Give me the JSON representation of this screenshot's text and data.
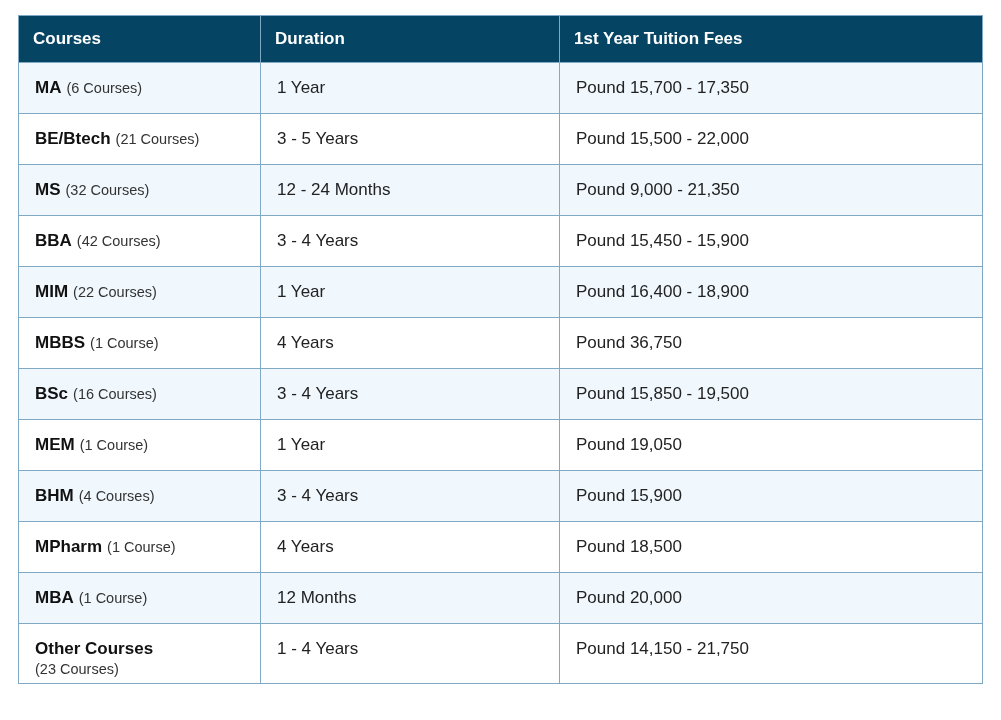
{
  "table": {
    "columns": [
      "Courses",
      "Duration",
      "1st Year Tuition Fees"
    ],
    "rows": [
      {
        "kind": "inline",
        "course": "MA",
        "count": "(6 Courses)",
        "duration": "1 Year",
        "fees": "Pound 15,700 - 17,350"
      },
      {
        "kind": "inline",
        "course": "BE/Btech",
        "count": "(21 Courses)",
        "duration": "3 - 5 Years",
        "fees": "Pound 15,500 - 22,000"
      },
      {
        "kind": "inline",
        "course": "MS",
        "count": "(32 Courses)",
        "duration": "12 - 24 Months",
        "fees": "Pound 9,000 - 21,350"
      },
      {
        "kind": "inline",
        "course": "BBA",
        "count": "(42 Courses)",
        "duration": "3 - 4 Years",
        "fees": "Pound 15,450 - 15,900"
      },
      {
        "kind": "inline",
        "course": "MIM",
        "count": "(22 Courses)",
        "duration": "1 Year",
        "fees": "Pound 16,400 - 18,900"
      },
      {
        "kind": "inline",
        "course": "MBBS",
        "count": "(1 Course)",
        "duration": "4 Years",
        "fees": "Pound 36,750"
      },
      {
        "kind": "inline",
        "course": "BSc",
        "count": "(16 Courses)",
        "duration": "3 - 4 Years",
        "fees": "Pound 15,850 - 19,500"
      },
      {
        "kind": "inline",
        "course": "MEM",
        "count": "(1 Course)",
        "duration": "1 Year",
        "fees": "Pound 19,050"
      },
      {
        "kind": "inline",
        "course": "BHM",
        "count": "(4 Courses)",
        "duration": "3 - 4 Years",
        "fees": "Pound 15,900"
      },
      {
        "kind": "inline",
        "course": "MPharm",
        "count": "(1 Course)",
        "duration": "4 Years",
        "fees": "Pound 18,500"
      },
      {
        "kind": "inline",
        "course": "MBA",
        "count": "(1 Course)",
        "duration": "12 Months",
        "fees": "Pound 20,000"
      },
      {
        "kind": "stacked",
        "course": "Other Courses",
        "count": "(23 Courses)",
        "duration": "1 - 4 Years",
        "fees": "Pound 14,150 - 21,750"
      }
    ]
  }
}
